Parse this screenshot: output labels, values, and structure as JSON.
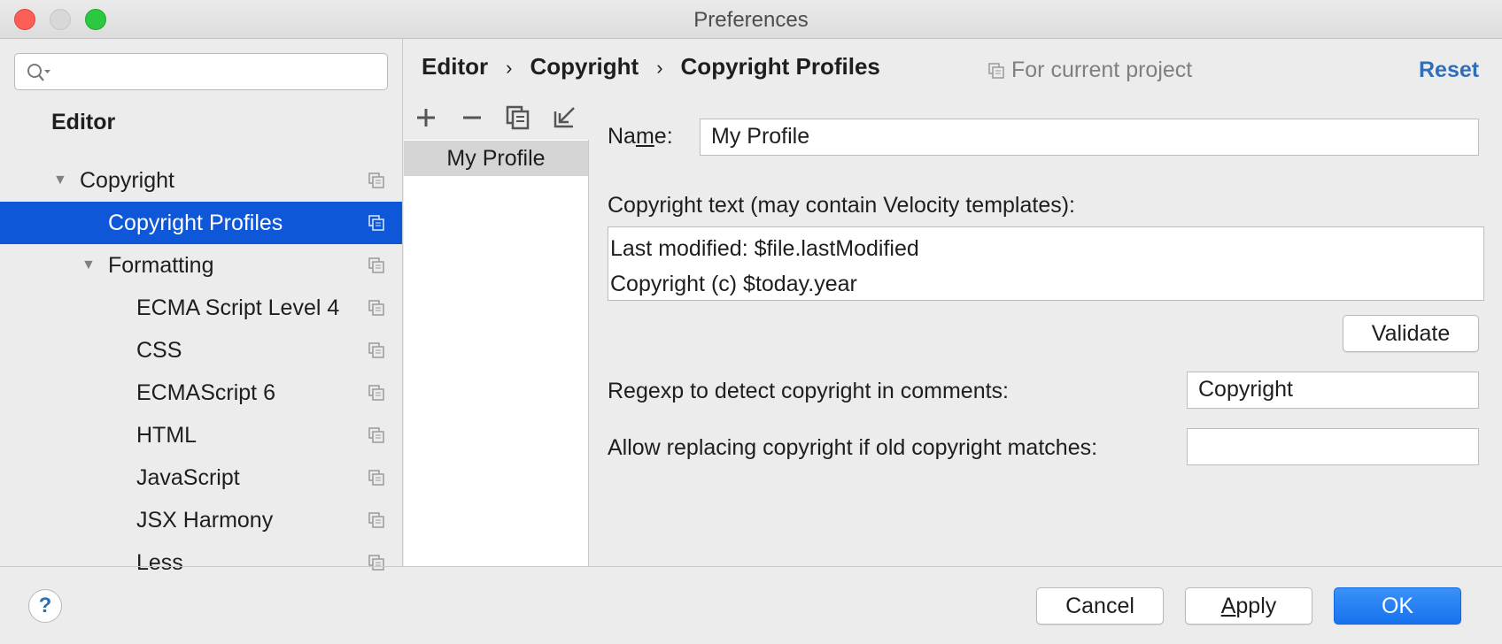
{
  "window": {
    "title": "Preferences"
  },
  "sidebar": {
    "search": {
      "placeholder": "",
      "value": ""
    },
    "heading": "Editor",
    "items": [
      {
        "label": "Copyright",
        "expanded": true
      },
      {
        "label": "Copyright Profiles",
        "selected": true
      },
      {
        "label": "Formatting",
        "expanded": true
      },
      {
        "label": "ECMA Script Level 4"
      },
      {
        "label": "CSS"
      },
      {
        "label": "ECMAScript 6"
      },
      {
        "label": "HTML"
      },
      {
        "label": "JavaScript"
      },
      {
        "label": "JSX Harmony"
      },
      {
        "label": "Less"
      }
    ]
  },
  "header": {
    "breadcrumb": [
      "Editor",
      "Copyright",
      "Copyright Profiles"
    ],
    "breadcrumb_separator": "›",
    "scope_label": "For current project",
    "reset_label": "Reset"
  },
  "profiles": {
    "toolbar": [
      "add-icon",
      "remove-icon",
      "copy-icon",
      "import-icon"
    ],
    "items": [
      {
        "label": "My Profile",
        "selected": true
      }
    ]
  },
  "form": {
    "name_label_pre": "Na",
    "name_label_mnemonic": "m",
    "name_label_post": "e:",
    "name_value": "My Profile",
    "copyright_text_label": "Copyright text (may contain Velocity templates):",
    "copyright_text_lines": [
      "Last modified: $file.lastModified",
      "Copyright (c) $today.year"
    ],
    "validate_label": "Validate",
    "regexp_label": "Regexp to detect copyright in comments:",
    "regexp_value": "Copyright",
    "replace_label": "Allow replacing copyright if old copyright matches:",
    "replace_value": ""
  },
  "footer": {
    "help_label": "?",
    "cancel_label": "Cancel",
    "apply_mnemonic": "A",
    "apply_rest": "pply",
    "ok_label": "OK"
  },
  "colors": {
    "selection": "#0d57d8",
    "link": "#2f6fba",
    "primary_button": "#1672ee"
  }
}
